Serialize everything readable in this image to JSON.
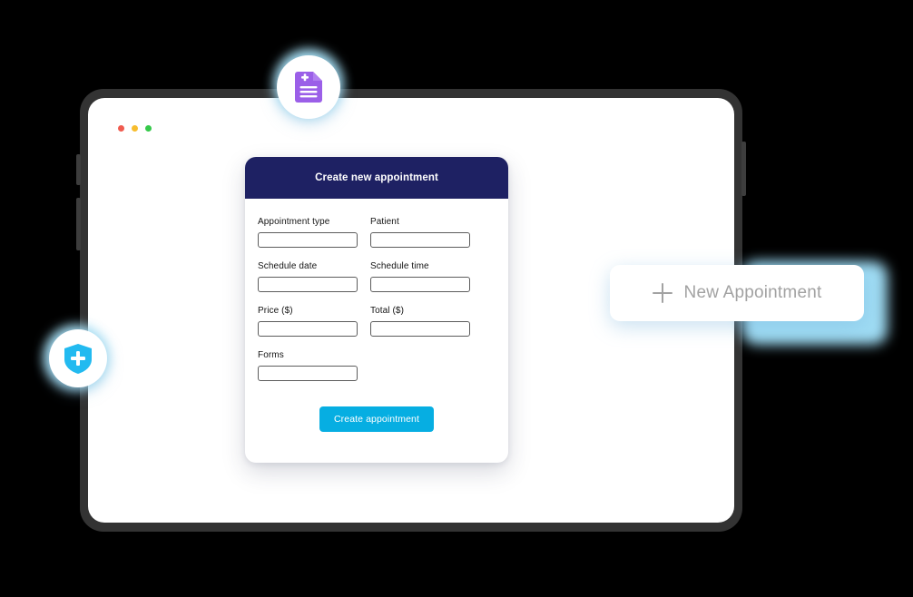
{
  "window_controls": {
    "close_label": "close",
    "minimize_label": "minimize",
    "maximize_label": "maximize"
  },
  "form_card": {
    "title": "Create new appointment",
    "header_color": "#1e2163",
    "fields": [
      {
        "label": "Appointment type",
        "value": "",
        "placeholder": ""
      },
      {
        "label": "Patient",
        "value": "",
        "placeholder": ""
      },
      {
        "label": "Schedule date",
        "value": "",
        "placeholder": ""
      },
      {
        "label": "Schedule time",
        "value": "",
        "placeholder": ""
      },
      {
        "label": "Price ($)",
        "value": "",
        "placeholder": ""
      },
      {
        "label": "Total ($)",
        "value": "",
        "placeholder": ""
      },
      {
        "label": "Forms",
        "value": "",
        "placeholder": ""
      }
    ],
    "submit_label": "Create appointment",
    "submit_color": "#06aee2"
  },
  "new_appointment_card": {
    "label": "New Appointment",
    "icon": "plus-icon",
    "text_color": "#a2a2a2",
    "glow_color": "#9fdcf4"
  },
  "badges": {
    "document": {
      "icon": "medical-document-icon",
      "color": "#9b5fe8"
    },
    "shield": {
      "icon": "medical-shield-icon",
      "color": "#22baf0"
    }
  },
  "device": {
    "frame_color": "#333333",
    "screen_color": "#ffffff"
  }
}
